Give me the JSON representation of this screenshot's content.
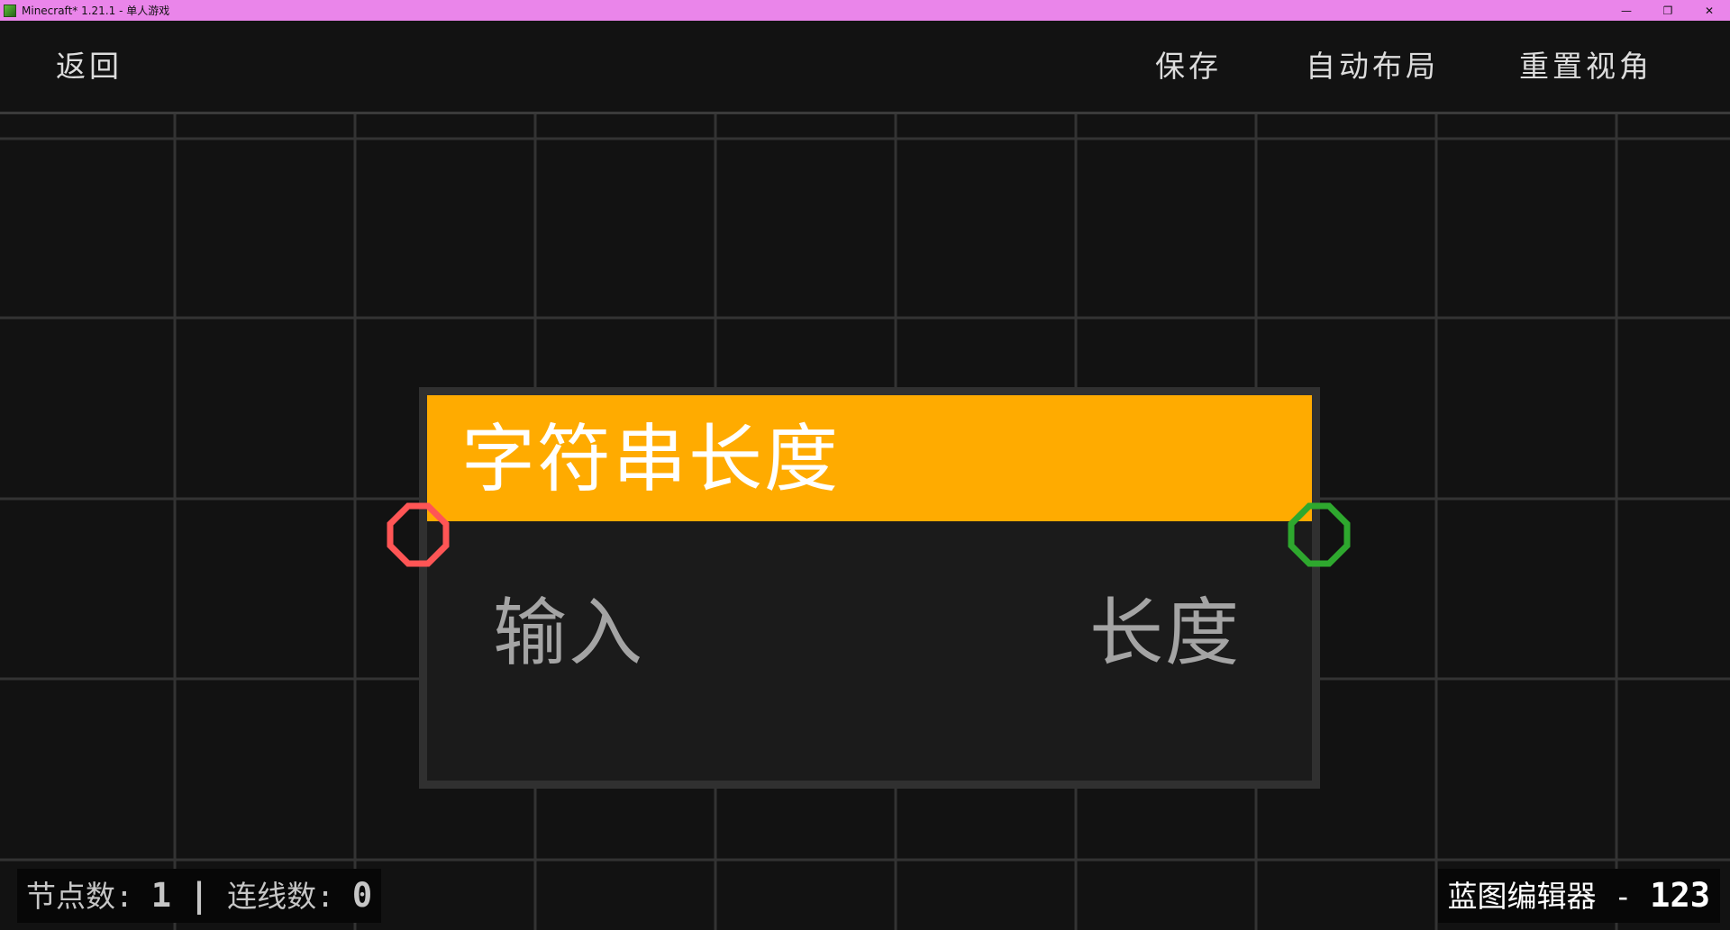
{
  "window": {
    "title": "Minecraft* 1.21.1 - 单人游戏",
    "minimize_glyph": "—",
    "restore_glyph": "❐",
    "close_glyph": "✕"
  },
  "toolbar": {
    "back_label": "返回",
    "save_label": "保存",
    "auto_layout_label": "自动布局",
    "reset_view_label": "重置视角"
  },
  "node": {
    "title": "字符串长度",
    "header_color": "#ffab00",
    "input_label": "输入",
    "output_label": "长度",
    "input_pin_color": "#ff5555",
    "output_pin_color": "#2ea82e"
  },
  "status": {
    "node_count_label": "节点数:",
    "node_count": "1",
    "separator": "|",
    "link_count_label": "连线数:",
    "link_count": "0"
  },
  "editor": {
    "name_label": "蓝图编辑器 -",
    "id": "123"
  }
}
